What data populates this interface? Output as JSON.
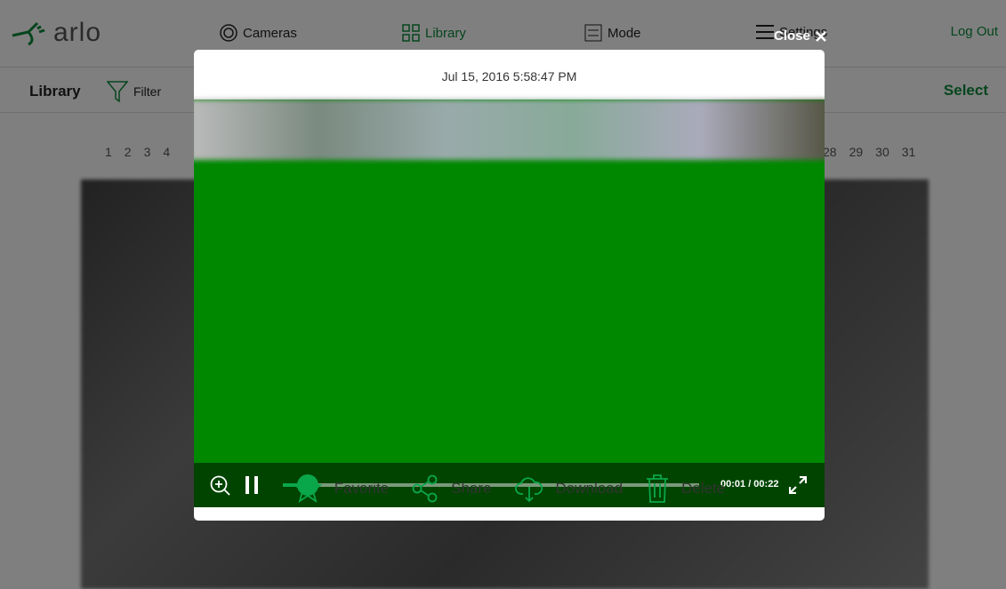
{
  "brand": {
    "logo": "arlo",
    "accent": "#0a8a3a"
  },
  "nav": {
    "cameras": "Cameras",
    "library": "Library",
    "mode": "Mode",
    "settings": "Settings",
    "logout": "Log Out"
  },
  "subbar": {
    "title": "Library",
    "filter": "Filter",
    "select": "Select"
  },
  "days_left": [
    "1",
    "2",
    "3",
    "4"
  ],
  "days_right": [
    "28",
    "29",
    "30",
    "31"
  ],
  "modal": {
    "close": "Close",
    "date": "Jul 15, 2016 5:58:47 PM",
    "player": {
      "time": "00:01 / 00:22",
      "progress_percent": 6,
      "state": "playing"
    },
    "actions": {
      "favorite": "Favorite",
      "share": "Share",
      "download": "Download",
      "delete": "Delete"
    }
  }
}
